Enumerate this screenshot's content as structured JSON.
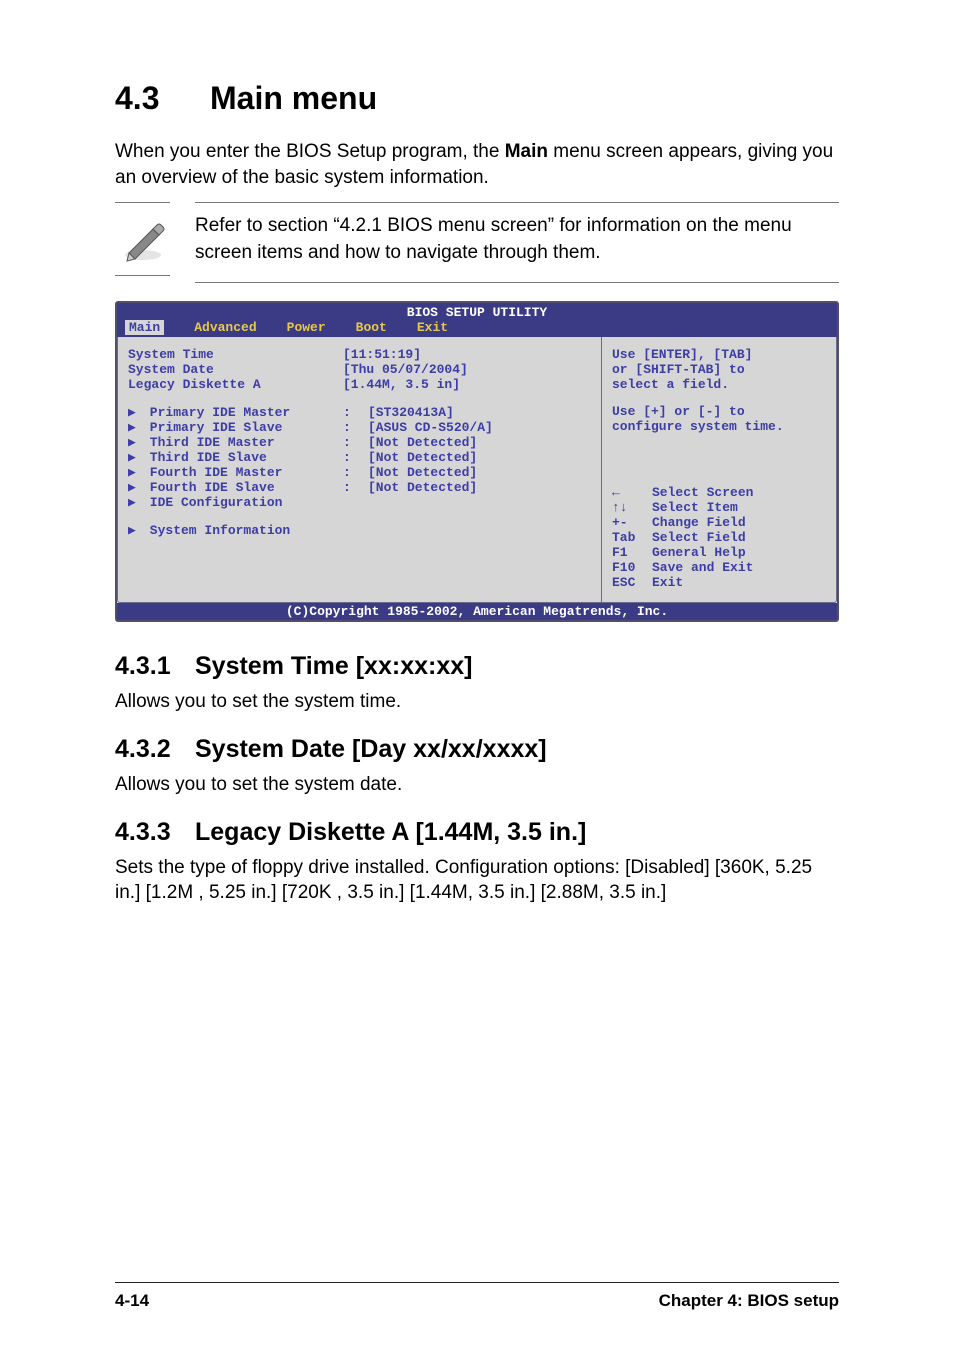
{
  "heading": {
    "number": "4.3",
    "title": "Main menu"
  },
  "intro": {
    "line1": "When you enter the BIOS Setup program, the ",
    "main_word": "Main",
    "line2": " menu screen appears, giving you an overview of the basic system information."
  },
  "note": "Refer to section “4.2.1  BIOS menu screen” for information on the menu screen items and how to navigate through them.",
  "bios": {
    "title": "BIOS SETUP UTILITY",
    "menu": [
      "Main",
      "Advanced",
      "Power",
      "Boot",
      "Exit"
    ],
    "active_index": 0,
    "settings_top": [
      {
        "label": "System Time",
        "value": "[11:51:19]"
      },
      {
        "label": "System Date",
        "value": "[Thu 05/07/2004]"
      },
      {
        "label": "Legacy Diskette A",
        "value": "[1.44M, 3.5 in]"
      }
    ],
    "settings_sub": [
      {
        "label": "Primary IDE Master",
        "value": "[ST320413A]"
      },
      {
        "label": "Primary IDE Slave",
        "value": "[ASUS CD-S520/A]"
      },
      {
        "label": "Third IDE Master",
        "value": "[Not Detected]"
      },
      {
        "label": "Third IDE Slave",
        "value": "[Not Detected]"
      },
      {
        "label": "Fourth IDE Master",
        "value": "[Not Detected]"
      },
      {
        "label": "Fourth IDE Slave",
        "value": "[Not Detected]"
      },
      {
        "label": "IDE Configuration",
        "value": ""
      }
    ],
    "settings_bottom": [
      {
        "label": "System Information",
        "value": ""
      }
    ],
    "help_top": "Use [ENTER], [TAB]\nor [SHIFT-TAB] to\nselect a field.",
    "help_mid": "Use [+] or [-] to\nconfigure system time.",
    "keys": [
      {
        "key": "←",
        "desc": "Select Screen"
      },
      {
        "key": "↑↓",
        "desc": "Select Item"
      },
      {
        "key": "+-",
        "desc": "Change Field"
      },
      {
        "key": "Tab",
        "desc": "Select Field"
      },
      {
        "key": "F1",
        "desc": "General Help"
      },
      {
        "key": "F10",
        "desc": "Save and Exit"
      },
      {
        "key": "ESC",
        "desc": "Exit"
      }
    ],
    "copyright": "(C)Copyright 1985-2002, American Megatrends, Inc."
  },
  "subsections": [
    {
      "number": "4.3.1",
      "title": "System Time [xx:xx:xx]",
      "body": "Allows you to set the system time."
    },
    {
      "number": "4.3.2",
      "title": "System Date [Day xx/xx/xxxx]",
      "body": "Allows you to set the system date."
    },
    {
      "number": "4.3.3",
      "title": "Legacy Diskette A [1.44M, 3.5 in.]",
      "body": "Sets the type of floppy drive installed. Configuration options: [Disabled] [360K, 5.25 in.] [1.2M , 5.25 in.] [720K , 3.5 in.] [1.44M, 3.5 in.] [2.88M, 3.5 in.]"
    }
  ],
  "footer": {
    "left": "4-14",
    "right": "Chapter 4: BIOS setup"
  }
}
